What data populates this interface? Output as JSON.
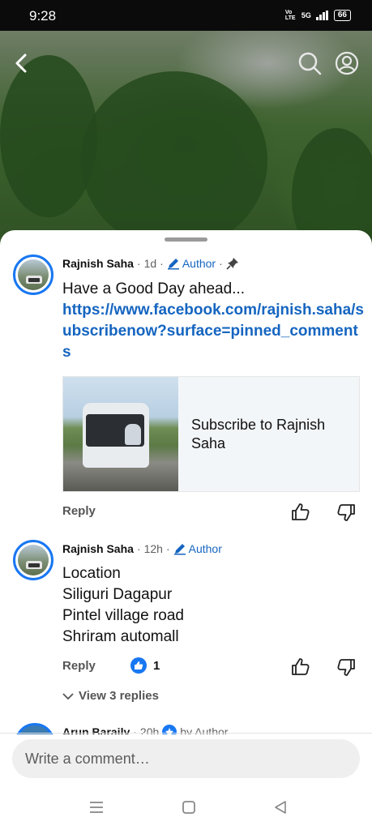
{
  "status_bar": {
    "time": "9:28",
    "network_label": "Vo LTE",
    "signal_label": "5G",
    "battery": "66"
  },
  "video": {
    "back_icon": "back-arrow-icon",
    "search_icon": "search-icon",
    "account_icon": "account-icon"
  },
  "comments": [
    {
      "name": "Rajnish Saha",
      "time": "1d",
      "author_label": "Author",
      "pinned": true,
      "text_intro": "Have a Good Day ahead...",
      "link": "https://www.facebook.com/rajnish.saha/subscribenow?surface=pinned_comments",
      "link_card_title": "Subscribe to Rajnish Saha",
      "reply_label": "Reply"
    },
    {
      "name": "Rajnish Saha",
      "time": "12h",
      "author_label": "Author",
      "lines": [
        "Location",
        "Siliguri Dagapur",
        "Pintel village road",
        "Shriram automall"
      ],
      "reply_label": "Reply",
      "likes": "1",
      "view_replies_label": "View 3 replies"
    },
    {
      "name": "Arun Baraily",
      "time": "20h",
      "by_author_label": "by Author"
    }
  ],
  "comment_input": {
    "placeholder": "Write a comment…"
  },
  "colors": {
    "accent": "#1877f2",
    "link": "#1565c0"
  }
}
